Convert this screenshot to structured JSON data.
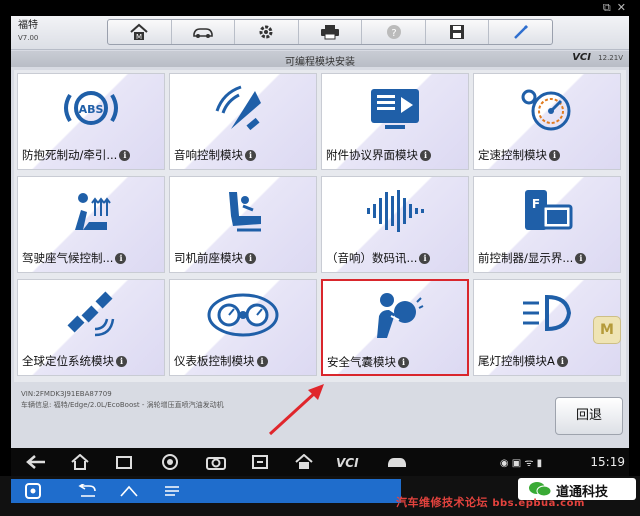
{
  "app": {
    "brand": "福特",
    "version": "V7.00"
  },
  "toolbar": {
    "items": [
      "home-icon",
      "car-icon",
      "gear-icon",
      "printer-icon",
      "help-icon",
      "save-icon",
      "pen-icon"
    ]
  },
  "subbar": {
    "title": "可编程模块安装",
    "vci": "VCI",
    "battery": "12.21V"
  },
  "tiles": [
    {
      "label": "防抱死制动/牵引...",
      "icon": "abs-icon"
    },
    {
      "label": "音响控制模块",
      "icon": "audio-icon"
    },
    {
      "label": "附件协议界面模块",
      "icon": "media-interface-icon"
    },
    {
      "label": "定速控制模块",
      "icon": "cruise-control-icon"
    },
    {
      "label": "驾驶座气候控制...",
      "icon": "seat-climate-icon"
    },
    {
      "label": "司机前座模块",
      "icon": "driver-seat-icon"
    },
    {
      "label": "（音响）数码讯...",
      "icon": "digital-signal-icon"
    },
    {
      "label": "前控制器/显示界...",
      "icon": "front-display-icon"
    },
    {
      "label": "全球定位系统模块",
      "icon": "satellite-icon"
    },
    {
      "label": "仪表板控制模块",
      "icon": "dashboard-icon"
    },
    {
      "label": "安全气囊模块",
      "icon": "airbag-icon"
    },
    {
      "label": "尾灯控制模块A",
      "icon": "tail-light-icon"
    }
  ],
  "vehicle": {
    "vin": "VIN:2FMDK3J91EBA87709",
    "info": "车辆信息: 福特/Edge/2.0L/EcoBoost - 涡轮增压直喷汽油发动机"
  },
  "back_label": "回退",
  "side_badge": "M",
  "nav": {
    "clock": "15:19"
  },
  "watermark": {
    "forum": "汽车维修技术论坛",
    "url": "bbs.epbua.com",
    "wechat": "道通科技"
  },
  "colors": {
    "selected_border": "#d9262c",
    "icon_blue": "#1f5fa8",
    "nav_blue": "#1f6dcc"
  }
}
